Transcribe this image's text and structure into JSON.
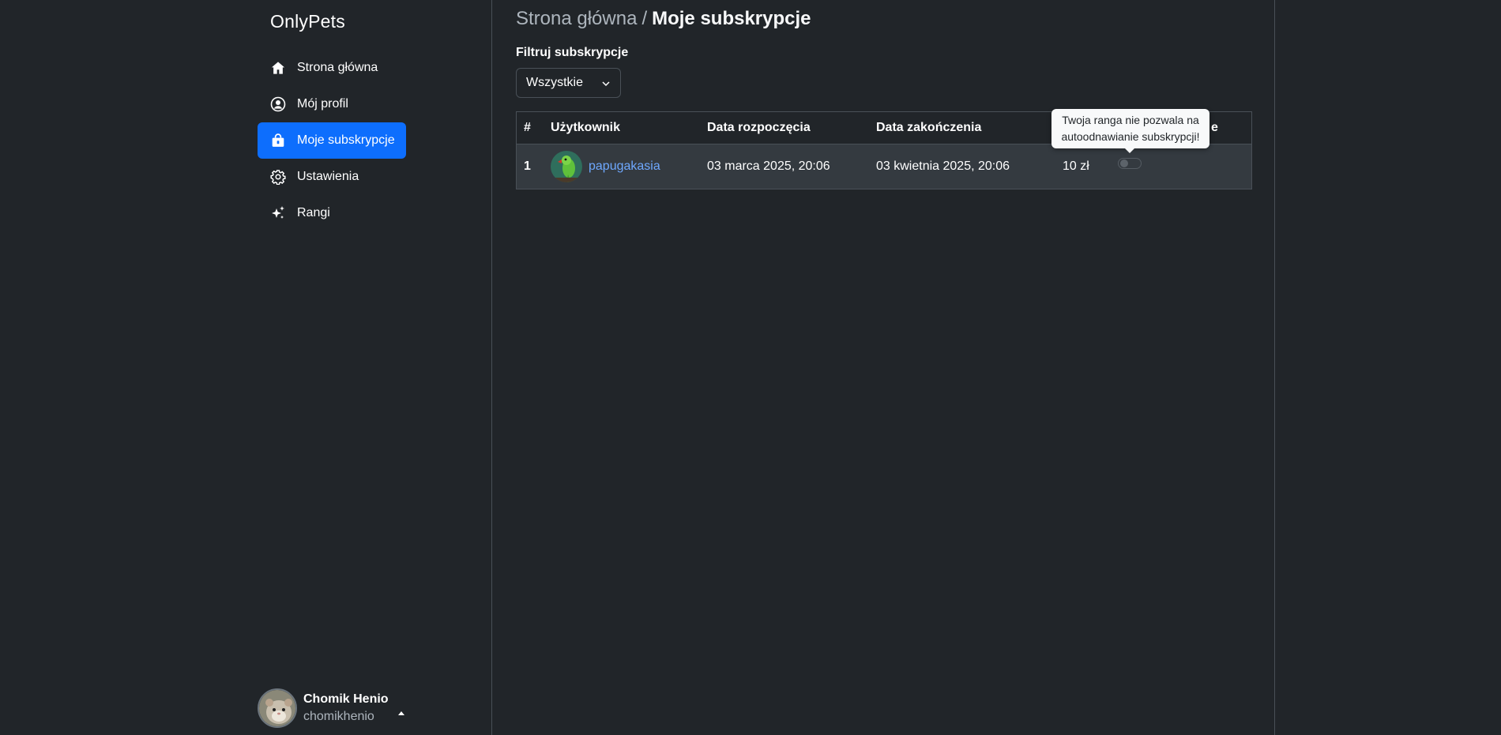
{
  "app": {
    "brand": "OnlyPets"
  },
  "sidebar": {
    "items": [
      {
        "label": "Strona główna",
        "icon": "home-icon",
        "active": false
      },
      {
        "label": "Mój profil",
        "icon": "person-circle-icon",
        "active": false
      },
      {
        "label": "Moje subskrypcje",
        "icon": "bag-lock-icon",
        "active": true
      },
      {
        "label": "Ustawienia",
        "icon": "gear-icon",
        "active": false
      },
      {
        "label": "Rangi",
        "icon": "sparkles-icon",
        "active": false
      }
    ],
    "user": {
      "name": "Chomik Henio",
      "login": "chomikhenio"
    }
  },
  "main": {
    "breadcrumb": {
      "link": "Strona główna",
      "separator": "/",
      "current": "Moje subskrypcje"
    },
    "filter": {
      "label": "Filtruj subskrypcje",
      "selected": "Wszystkie"
    },
    "table": {
      "headers": [
        "#",
        "Użytkownik",
        "Data rozpoczęcia",
        "Data zakończenia",
        "",
        "e"
      ],
      "rows": [
        {
          "index": "1",
          "user": "papugakasia",
          "start": "03 marca 2025, 20:06",
          "end": "03 kwietnia 2025, 20:06",
          "price": "10 zł",
          "auto_renew": false
        }
      ]
    },
    "tooltip": "Twoja ranga nie pozwala na autoodnawianie subskrypcji!"
  },
  "colors": {
    "background": "#212529",
    "accent": "#0d6efd",
    "link": "#6ea8fe",
    "row": "#343a40",
    "border": "#495057"
  }
}
